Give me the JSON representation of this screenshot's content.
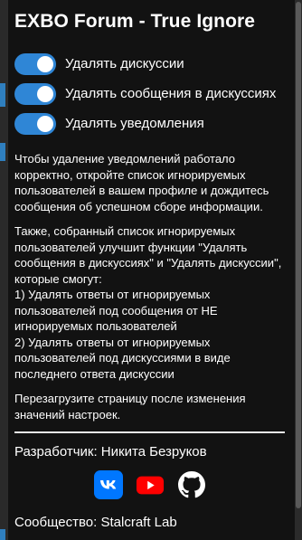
{
  "title": "EXBO Forum - True Ignore",
  "toggles": [
    {
      "label": "Удалять дискуссии",
      "on": true
    },
    {
      "label": "Удалять сообщения в дискуссиях",
      "on": true
    },
    {
      "label": "Удалять уведомления",
      "on": true
    }
  ],
  "info": {
    "p1": "Чтобы удаление уведомлений работало корректно, откройте список игнорируемых пользователей в вашем профиле и дождитесь сообщения об успешном сборе информации.",
    "p2_lines": [
      "Также, собранный список игнорируемых пользователей улучшит функции \"Удалять сообщения в дискуссиях\" и \"Удалять дискуссии\", которые смогут:",
      "1) Удалять ответы от игнорируемых пользователей под сообщения от НЕ игнорируемых пользователей",
      "2) Удалять ответы от игнорируемых пользователей под дискуссиями в виде последнего ответа дискуссии"
    ],
    "p3": "Перезагрузите страницу после изменения значений настроек."
  },
  "developer": "Разработчик: Никита Безруков",
  "links": [
    {
      "icon": "vk-icon",
      "color": "#0077ff"
    },
    {
      "icon": "youtube-icon",
      "color": "#ff0000"
    },
    {
      "icon": "github-icon",
      "color": "#ffffff"
    }
  ],
  "community": "Сообщество: Stalcraft Lab"
}
